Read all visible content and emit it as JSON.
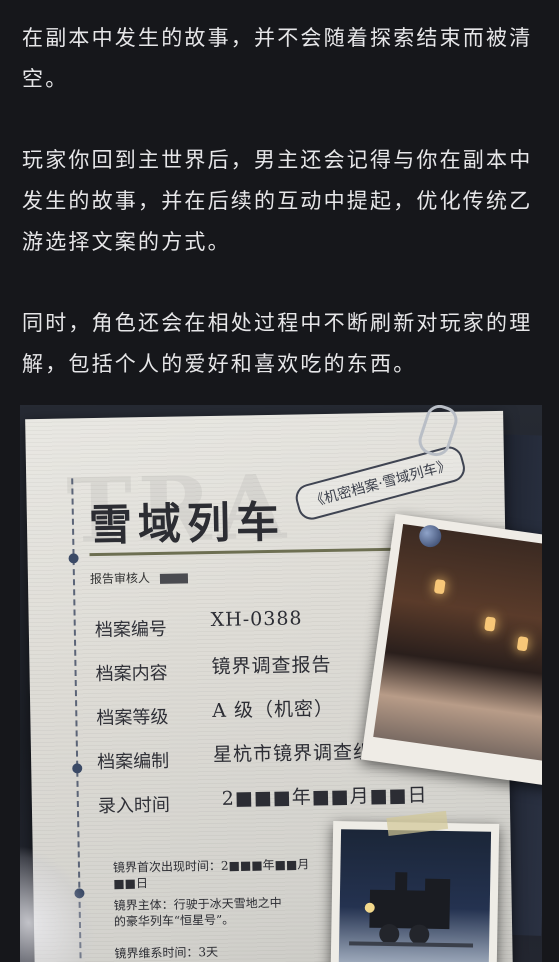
{
  "article": {
    "paragraphs": [
      "在副本中发生的故事，并不会随着探索结束而被清空。",
      "玩家你回到主世界后，男主还会记得与你在副本中发生的故事，并在后续的互动中提起，优化传统乙游选择文案的方式。",
      "同时，角色还会在相处过程中不断刷新对玩家的理解，包括个人的爱好和喜欢吃的东西。"
    ]
  },
  "document": {
    "title": "雪域列车",
    "stamp": "《机密档案·雪域列车》",
    "reviewer_label": "报告审核人",
    "fields": [
      {
        "label": "档案编号",
        "value": "XH-0388"
      },
      {
        "label": "档案内容",
        "value": "镜界调查报告"
      },
      {
        "label": "档案等级",
        "value": "A 级（机密）"
      },
      {
        "label": "档案编制",
        "value": "星杭市镜界调查组"
      },
      {
        "label": "录入时间",
        "value": "2■■■年■■月■■日"
      }
    ],
    "first_appearance": "镜界首次出现时间：2■■■年■■月■■日",
    "subject_line1": "镜界主体：行驶于冰天雪地之中",
    "subject_line2": "的豪华列车“恒星号”。",
    "duration": "镜界维系时间：3天"
  },
  "colors": {
    "background": "#16171b",
    "text": "#e6e6e8",
    "paper": "#e3e2dd"
  }
}
